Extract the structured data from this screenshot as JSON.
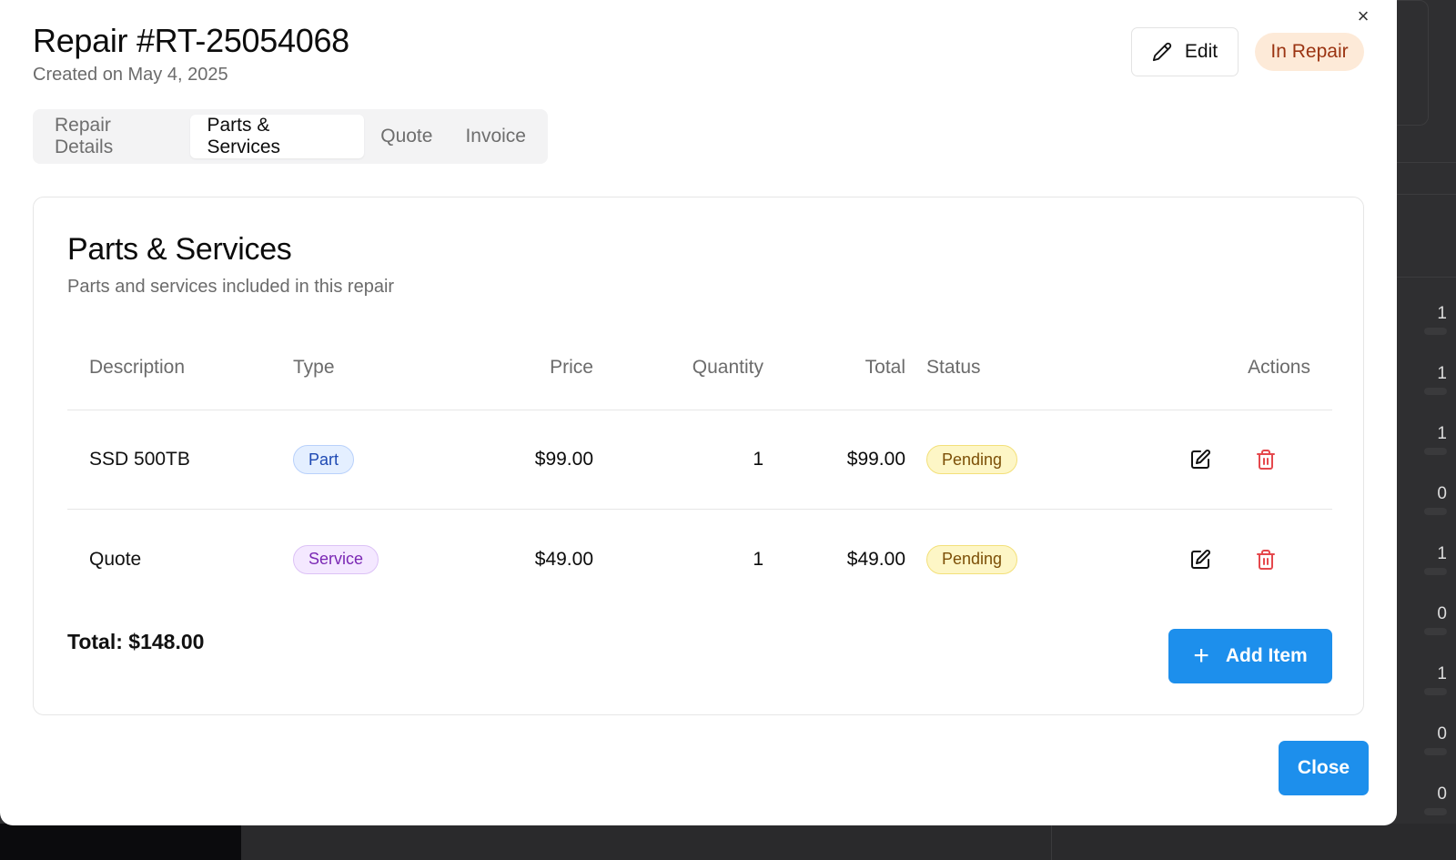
{
  "modal": {
    "title": "Repair #RT-25054068",
    "subtitle": "Created on May 4, 2025",
    "edit_label": "Edit",
    "status": "In Repair",
    "close_icon": "×",
    "close_label": "Close"
  },
  "tabs": [
    {
      "label": "Repair Details",
      "active": false
    },
    {
      "label": "Parts & Services",
      "active": true
    },
    {
      "label": "Quote",
      "active": false
    },
    {
      "label": "Invoice",
      "active": false
    }
  ],
  "card": {
    "title": "Parts & Services",
    "description": "Parts and services included in this repair"
  },
  "table": {
    "headers": [
      "Description",
      "Type",
      "Price",
      "Quantity",
      "Total",
      "Status",
      "Actions"
    ],
    "rows": [
      {
        "description": "SSD 500TB",
        "type": "Part",
        "price": "$99.00",
        "quantity": "1",
        "total": "$99.00",
        "status": "Pending"
      },
      {
        "description": "Quote",
        "type": "Service",
        "price": "$49.00",
        "quantity": "1",
        "total": "$49.00",
        "status": "Pending"
      }
    ]
  },
  "footer": {
    "total_label": "Total: $148.00",
    "add_item_label": "Add Item",
    "add_icon": "+"
  },
  "background": {
    "values": [
      "1",
      "1",
      "1",
      "0",
      "1",
      "0",
      "1",
      "0",
      "0"
    ]
  },
  "colors": {
    "primary": "#1d8fec",
    "status_in_repair_bg": "#fdead8",
    "status_in_repair_text": "#9b3412",
    "delete": "#e5484d"
  }
}
